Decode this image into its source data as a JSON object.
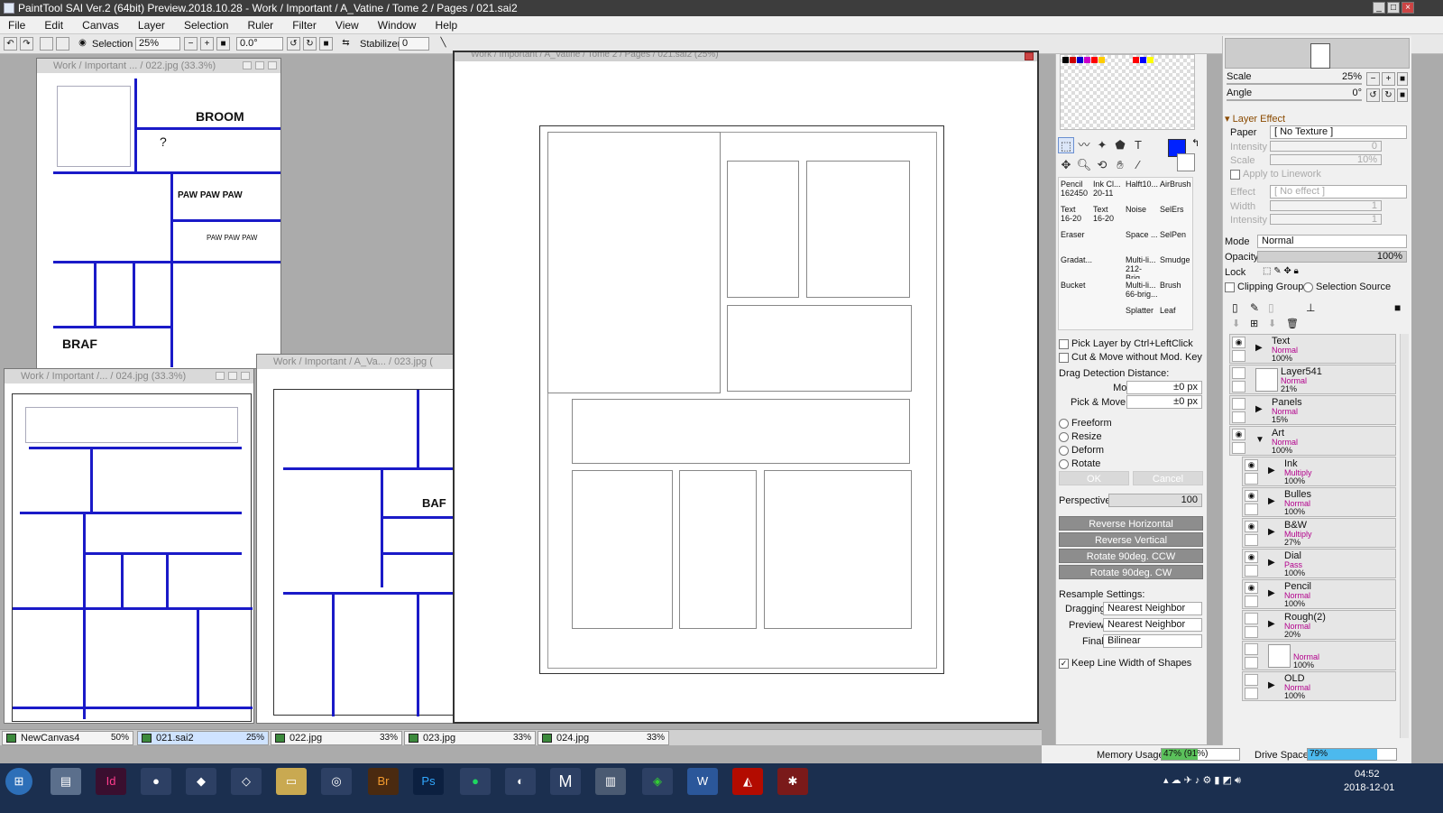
{
  "window": {
    "title": "PaintTool SAI Ver.2 (64bit) Preview.2018.10.28 - Work / Important / A_Vatine / Tome 2 / Pages / 021.sai2"
  },
  "menu": [
    "File",
    "Edit",
    "Canvas",
    "Layer",
    "Selection",
    "Ruler",
    "Filter",
    "View",
    "Window",
    "Help"
  ],
  "toolbar": {
    "selection_label": "Selection",
    "zoom": "25%",
    "angle": "0.0°",
    "stabilizer_label": "Stabilizer",
    "stabilizer_value": "0"
  },
  "docs": {
    "w022": "Work / Important ... / 022.jpg (33.3%)",
    "w024": "Work / Important /... / 024.jpg (33.3%)",
    "w023": "Work / Important / A_Va... / 023.jpg (",
    "main": "Work / Important / A_Vatine / Tome 2 / Pages / 021.sai2 (25%)"
  },
  "sketch_text": {
    "b1": "BROOM",
    "b2": "?",
    "b3": "PAW PAW PAW",
    "b4": "PAW PAW PAW",
    "b5": "BRAF",
    "b6": "BAF"
  },
  "tabs": [
    {
      "name": "NewCanvas4",
      "zoom": "50%"
    },
    {
      "name": "021.sai2",
      "zoom": "25%"
    },
    {
      "name": "022.jpg",
      "zoom": "33%"
    },
    {
      "name": "023.jpg",
      "zoom": "33%"
    },
    {
      "name": "024.jpg",
      "zoom": "33%"
    }
  ],
  "colors": {
    "primary": "#0022ff",
    "panel_blue": "#1a1ac8"
  },
  "brushes": [
    {
      "name": "Pencil",
      "size": "162450"
    },
    {
      "name": "Ink Cl...",
      "size": "20-11"
    },
    {
      "name": "Halft10...",
      "size": ""
    },
    {
      "name": "AirBrush",
      "size": ""
    },
    {
      "name": "Text",
      "size": "16-20"
    },
    {
      "name": "Text",
      "size": "16-20"
    },
    {
      "name": "Noise",
      "size": ""
    },
    {
      "name": "SelErs",
      "size": ""
    },
    {
      "name": "Eraser",
      "size": ""
    },
    {
      "name": "",
      "size": ""
    },
    {
      "name": "Space ...",
      "size": ""
    },
    {
      "name": "SelPen",
      "size": ""
    },
    {
      "name": "Gradat...",
      "size": ""
    },
    {
      "name": "",
      "size": ""
    },
    {
      "name": "Multi-li...",
      "size": "212-Brig..."
    },
    {
      "name": "Smudge",
      "size": ""
    },
    {
      "name": "Bucket",
      "size": ""
    },
    {
      "name": "",
      "size": ""
    },
    {
      "name": "Multi-li...",
      "size": "66-brig..."
    },
    {
      "name": "Brush",
      "size": ""
    },
    {
      "name": "",
      "size": ""
    },
    {
      "name": "",
      "size": ""
    },
    {
      "name": "Splatter",
      "size": ""
    },
    {
      "name": "Leaf",
      "size": ""
    }
  ],
  "tool_opts": {
    "pick_layer": "Pick Layer by Ctrl+LeftClick",
    "cut_move": "Cut & Move without Mod. Key",
    "drag_title": "Drag Detection Distance:",
    "move_label": "Move",
    "move_value": "±0 px",
    "pick_label": "Pick & Move",
    "pick_value": "±0 px",
    "freeform": "Freeform",
    "resize": "Resize",
    "deform": "Deform",
    "rotate": "Rotate",
    "ok": "OK",
    "cancel": "Cancel",
    "perspective_label": "Perspective",
    "perspective_value": "100",
    "rev_h": "Reverse Horizontal",
    "rev_v": "Reverse Vertical",
    "rot_ccw": "Rotate 90deg. CCW",
    "rot_cw": "Rotate 90deg. CW",
    "resample_title": "Resample Settings:",
    "dragging_label": "Dragging",
    "dragging_value": "Nearest Neighbor",
    "preview_label": "Preview",
    "preview_value": "Nearest Neighbor",
    "final_label": "Final",
    "final_value": "Bilinear",
    "keep_line": "Keep Line Width of Shapes"
  },
  "nav": {
    "scale_label": "Scale",
    "scale_value": "25%",
    "angle_label": "Angle",
    "angle_value": "0°"
  },
  "layer_effect": {
    "title": "Layer Effect",
    "paper_label": "Paper",
    "paper_value": "[ No Texture ]",
    "intensity_label": "Intensity",
    "intensity_value": "0",
    "scale_label": "Scale",
    "scale_value": "10%",
    "apply_label": "Apply to Linework",
    "effect_label": "Effect",
    "effect_value": "[ No effect ]",
    "width_label": "Width",
    "width_value": "1",
    "intensity2_label": "Intensity",
    "intensity2_value": "1"
  },
  "layer_props": {
    "mode_label": "Mode",
    "mode_value": "Normal",
    "opacity_label": "Opacity",
    "opacity_value": "100%",
    "lock_label": "Lock",
    "clipping": "Clipping Group",
    "selsource": "Selection Source"
  },
  "layers": [
    {
      "name": "Text",
      "mode": "Normal",
      "opacity": "100%",
      "visible": true,
      "indent": 0,
      "folder": true
    },
    {
      "name": "Layer541",
      "mode": "Normal",
      "opacity": "21%",
      "visible": false,
      "indent": 0,
      "folder": false
    },
    {
      "name": "Panels",
      "mode": "Normal",
      "opacity": "15%",
      "visible": false,
      "indent": 0,
      "folder": true
    },
    {
      "name": "Art",
      "mode": "Normal",
      "opacity": "100%",
      "visible": true,
      "indent": 0,
      "folder": true,
      "open": true
    },
    {
      "name": "Ink",
      "mode": "Multiply",
      "opacity": "100%",
      "visible": true,
      "indent": 1,
      "folder": true
    },
    {
      "name": "Bulles",
      "mode": "Normal",
      "opacity": "100%",
      "visible": true,
      "indent": 1,
      "folder": true
    },
    {
      "name": "B&W",
      "mode": "Multiply",
      "opacity": "27%",
      "visible": true,
      "indent": 1,
      "folder": true
    },
    {
      "name": "Dial",
      "mode": "Pass",
      "opacity": "100%",
      "visible": true,
      "indent": 1,
      "folder": true
    },
    {
      "name": "Pencil",
      "mode": "Normal",
      "opacity": "100%",
      "visible": true,
      "indent": 1,
      "folder": true
    },
    {
      "name": "Rough(2)",
      "mode": "Normal",
      "opacity": "20%",
      "visible": false,
      "indent": 1,
      "folder": true
    },
    {
      "name": "",
      "mode": "Normal",
      "opacity": "100%",
      "visible": false,
      "indent": 1,
      "folder": false
    },
    {
      "name": "OLD",
      "mode": "Normal",
      "opacity": "100%",
      "visible": false,
      "indent": 1,
      "folder": true
    }
  ],
  "status": {
    "memory_label": "Memory Usage",
    "memory_value": "47% (91%)",
    "memory_fraction": 0.47,
    "drive_label": "Drive Space",
    "drive_value": "79%",
    "drive_fraction": 0.79
  },
  "taskbar": {
    "time": "04:52",
    "date": "2018-12-01",
    "apps": [
      "Id",
      "Br",
      "Ps",
      "M"
    ]
  }
}
